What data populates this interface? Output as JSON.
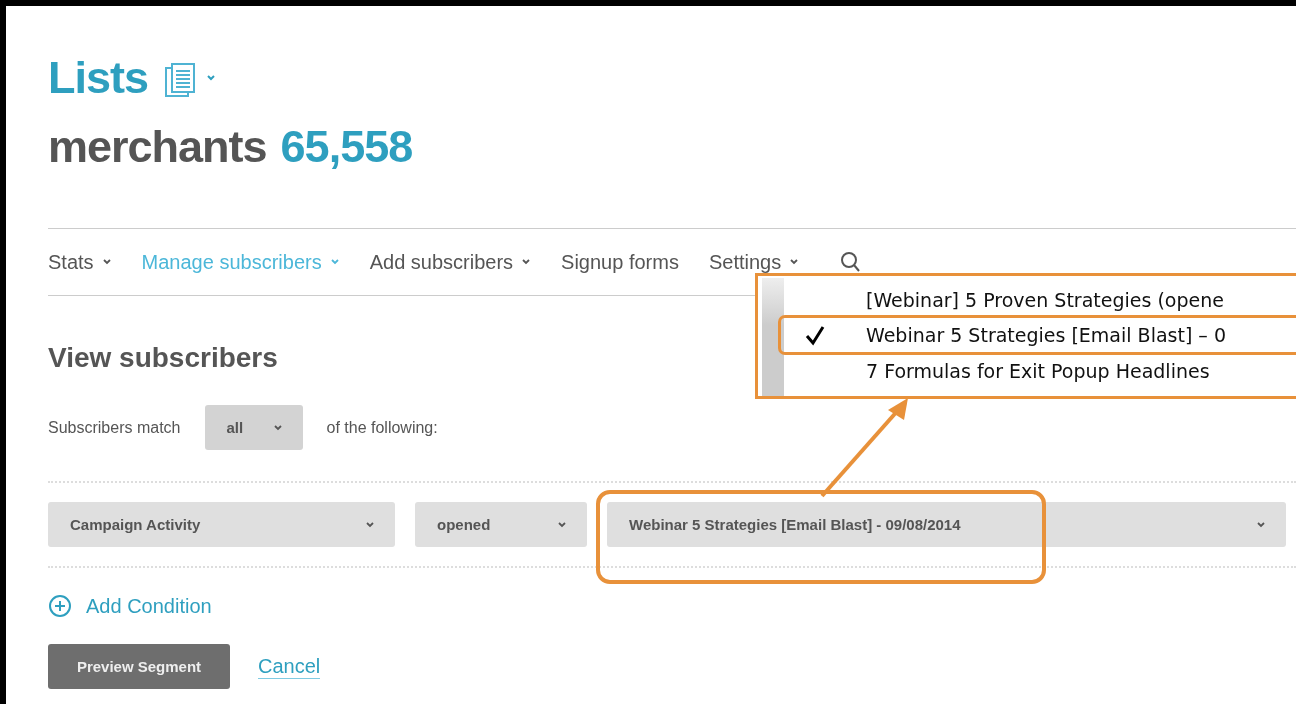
{
  "header": {
    "title": "Lists",
    "list_name": "merchants",
    "count": "65,558"
  },
  "nav": [
    {
      "label": "Stats",
      "dropdown": true,
      "selected": false
    },
    {
      "label": "Manage subscribers",
      "dropdown": true,
      "selected": true
    },
    {
      "label": "Add subscribers",
      "dropdown": true,
      "selected": false
    },
    {
      "label": "Signup forms",
      "dropdown": false,
      "selected": false
    },
    {
      "label": "Settings",
      "dropdown": true,
      "selected": false
    }
  ],
  "popup": {
    "items": [
      {
        "label": "[Webinar] 5 Proven Strategies (opene",
        "selected": false
      },
      {
        "label": "Webinar 5 Strategies [Email Blast] – 0",
        "selected": true
      },
      {
        "label": "7 Formulas for Exit Popup Headlines",
        "selected": false
      }
    ]
  },
  "view": {
    "title": "View subscribers",
    "match_prefix": "Subscribers match",
    "match_value": "all",
    "match_suffix": "of the following:"
  },
  "condition": {
    "field": "Campaign Activity",
    "operator": "opened",
    "campaign": "Webinar 5 Strategies [Email Blast] - 09/08/2014"
  },
  "add_condition": "Add Condition",
  "buttons": {
    "preview": "Preview Segment",
    "cancel": "Cancel"
  }
}
